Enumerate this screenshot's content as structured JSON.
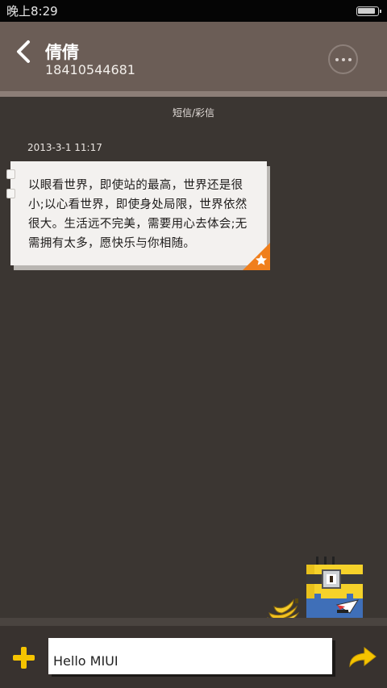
{
  "status_bar": {
    "time": "晚上8:29",
    "battery_level": 0.9
  },
  "header": {
    "contact_name": "倩倩",
    "contact_number": "18410544681",
    "back_icon": "back-chevron-icon",
    "more_icon": "more-dots-icon"
  },
  "conversation": {
    "type_label": "短信/彩信",
    "messages": [
      {
        "time": "2013-3-1 11:17",
        "text": "以眼看世界，即使站的最高，世界还是很小;以心看世界，即使身处局限，世界依然很大。生活远不完美，需要用心去体会;无需拥有太多，愿快乐与你相随。",
        "starred": true
      }
    ]
  },
  "composer": {
    "input_value": "Hello MIUI",
    "plus_icon": "plus-icon",
    "send_icon": "send-arrow-icon"
  },
  "colors": {
    "accent": "#f5c400",
    "header_bg": "#6b5d56",
    "page_bg": "#3b3632",
    "star_corner": "#f07f1c"
  }
}
